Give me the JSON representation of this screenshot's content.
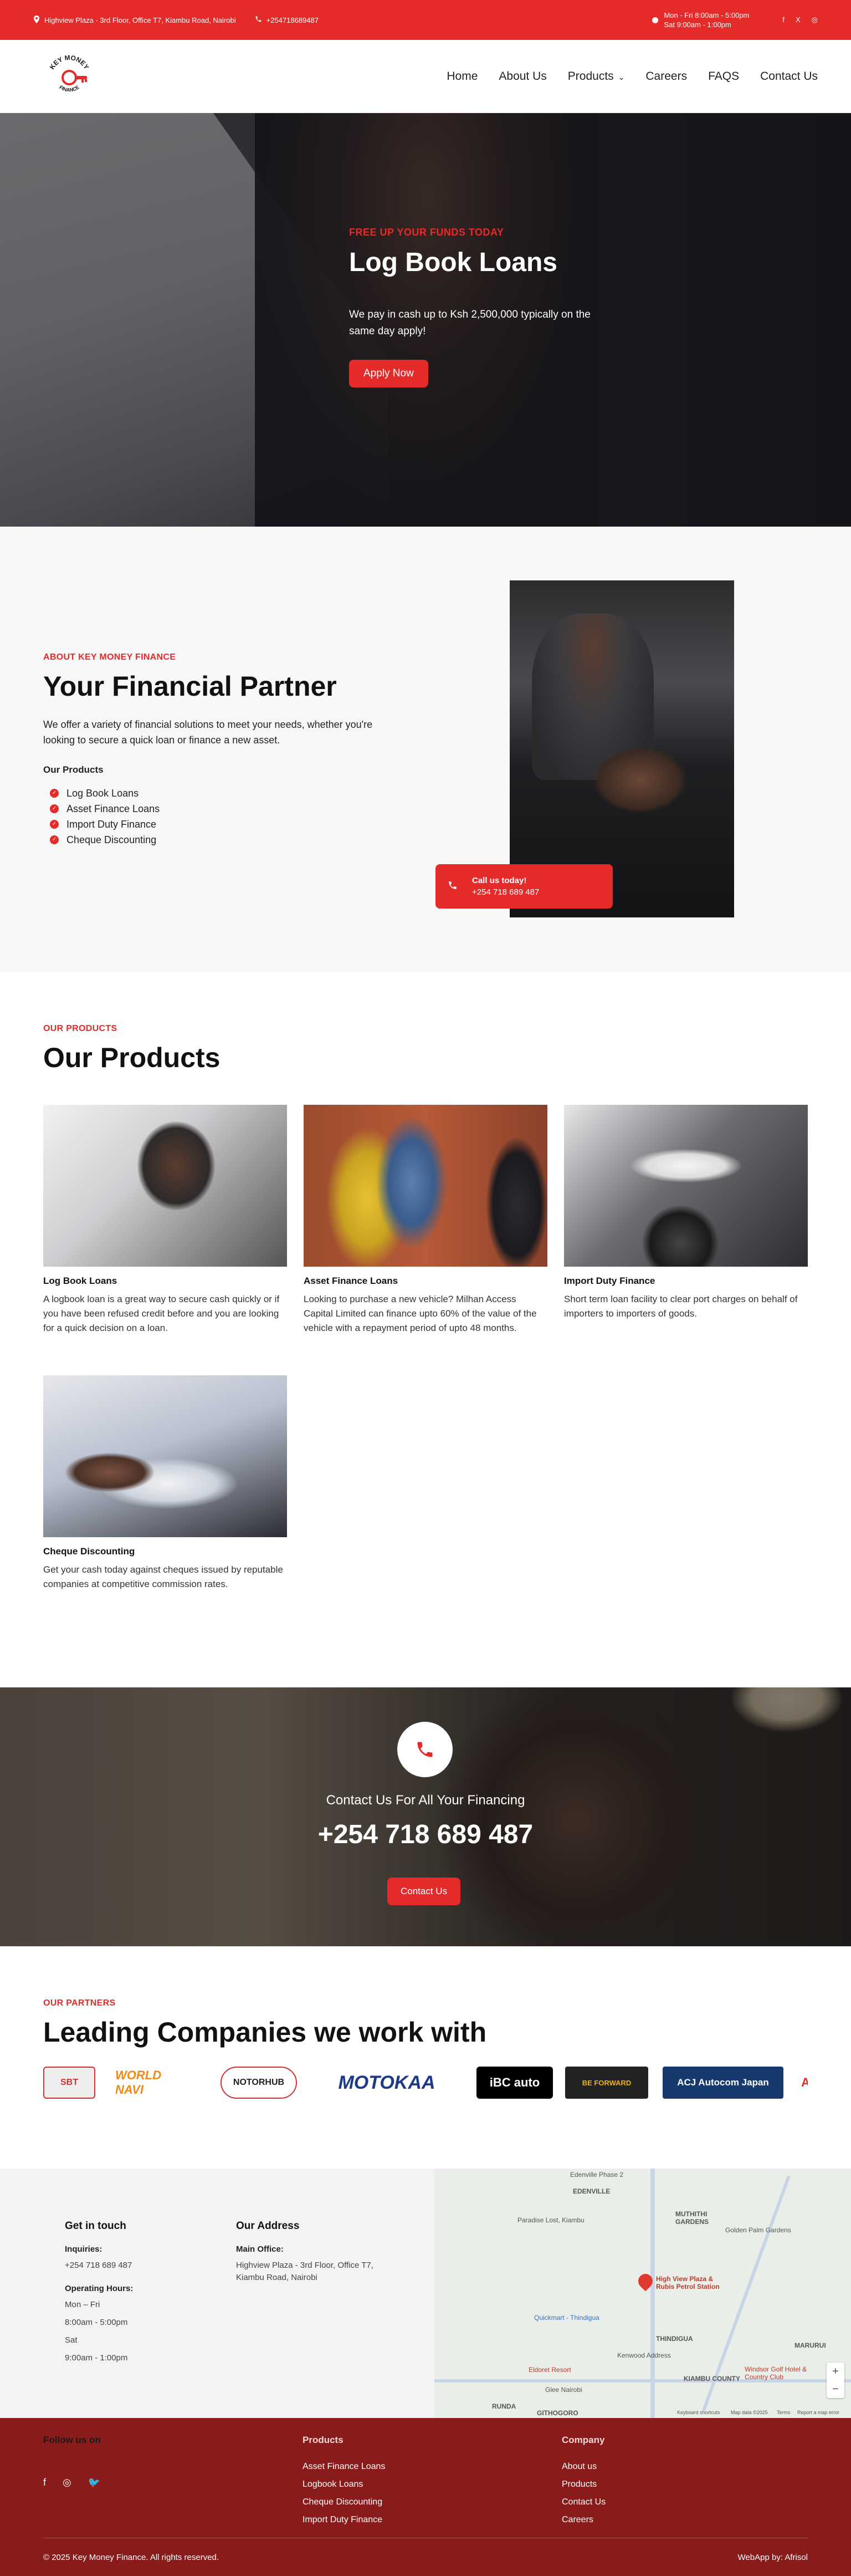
{
  "topbar": {
    "address": "Highview Plaza - 3rd Floor, Office T7, Kiambu Road, Nairobi",
    "phone": "+254718689487",
    "hours_line1": "Mon - Fri 8:00am - 5:00pm",
    "hours_line2": "Sat 9:00am - 1:00pm",
    "social": [
      "f",
      "X",
      "◎"
    ]
  },
  "brand": {
    "logo_text": "KEY MONEY FINANCE"
  },
  "nav": {
    "items": [
      "Home",
      "About Us",
      "Products",
      "Careers",
      "FAQS",
      "Contact Us"
    ]
  },
  "hero": {
    "kicker": "FREE UP YOUR FUNDS TODAY",
    "title": "Log Book Loans",
    "text": "We pay in cash up to Ksh 2,500,000 typically on the same day apply!",
    "button": "Apply Now"
  },
  "about": {
    "kicker": "ABOUT KEY MONEY FINANCE",
    "title": "Your Financial Partner",
    "text": "We offer a variety of financial solutions to meet your needs, whether you're looking to secure a quick loan or finance a new asset.",
    "sub": "Our Products",
    "list": [
      "Log Book Loans",
      "Asset Finance Loans",
      "Import Duty Finance",
      "Cheque Discounting"
    ],
    "call_title": "Call us today!",
    "call_phone": "+254 718 689 487"
  },
  "products": {
    "kicker": "OUR PRODUCTS",
    "title": "Our Products",
    "items": [
      {
        "name": "Log Book Loans",
        "desc": "A logbook loan is a great way to secure cash quickly or if you have been refused credit before and you are looking for a quick decision on a loan."
      },
      {
        "name": "Asset Finance Loans",
        "desc": "Looking to purchase a new vehicle? Milhan Access Capital Limited can finance upto 60% of the value of the vehicle with a repayment period of upto 48 months."
      },
      {
        "name": "Import Duty Finance",
        "desc": "Short term loan facility to clear port charges on behalf of importers to importers of goods."
      },
      {
        "name": "Cheque Discounting",
        "desc": "Get your cash today against cheques issued by reputable companies at competitive commission rates."
      }
    ]
  },
  "contact_banner": {
    "text": "Contact Us For All Your Financing",
    "phone": "+254 718 689 487",
    "button": "Contact Us"
  },
  "partners": {
    "kicker": "OUR PARTNERS",
    "title": "Leading Companies we work with",
    "logos": [
      "SBT",
      "WORLD NAVI",
      "NOTORHUB",
      "MOTOKAA",
      "iBC auto",
      "BE FORWARD",
      "ACJ Autocom Japan"
    ]
  },
  "footer_top": {
    "contact_title": "Get in touch",
    "inquiries_label": "Inquiries:",
    "inquiries_value": "+254 718 689 487",
    "hours_label": "Operating Hours:",
    "hours": [
      "Mon – Fri",
      "8:00am - 5:00pm",
      "Sat",
      "9:00am - 1:00pm"
    ],
    "address_title": "Our Address",
    "office_label": "Main Office:",
    "office_value": "Highview Plaza - 3rd Floor, Office T7, Kiambu Road, Nairobi",
    "map": {
      "place": "High View Plaza & Rubis Petrol Station",
      "labels": [
        "EDENVILLE",
        "MUTHITHI GARDENS",
        "Golden Palm Gardens",
        "KIAMBU COUNTY",
        "THINDIGUA",
        "Windsor Golf Hotel & Country Club",
        "Quickmart - Thindigua",
        "Kenwood Address",
        "Eldoret Resort",
        "Edenville Phase 2",
        "Paradise Lost, Kiambu",
        "Keyboard shortcuts",
        "Map data ©2025",
        "Terms",
        "Report a map error",
        "Glee Nairobi",
        "MARURUI",
        "GITHOGORO",
        "RUNDA"
      ]
    }
  },
  "footer_bottom": {
    "follow_title": "Follow us on",
    "social": [
      "f",
      "◎",
      "🐦"
    ],
    "products_title": "Products",
    "products_links": [
      "Asset Finance Loans",
      "Logbook Loans",
      "Cheque Discounting",
      "Import Duty Finance"
    ],
    "company_title": "Company",
    "company_links": [
      "About us",
      "Products",
      "Contact Us",
      "Careers"
    ],
    "copyright": "© 2025 Key Money Finance. All rights reserved.",
    "credit": "WebApp by: Afrisol"
  },
  "colors": {
    "accent": "#e52a2a",
    "footer": "#8a1b1b"
  }
}
